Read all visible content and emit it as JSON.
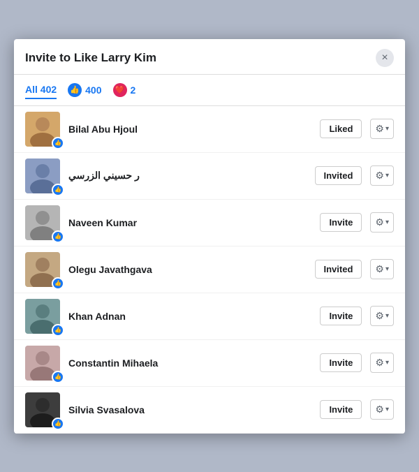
{
  "modal": {
    "title": "Invite to Like Larry Kim",
    "close_label": "×"
  },
  "tabs": [
    {
      "id": "all",
      "label": "All 402",
      "icon": null,
      "active": true
    },
    {
      "id": "like",
      "label": "400",
      "icon": "like",
      "active": false
    },
    {
      "id": "love",
      "label": "2",
      "icon": "love",
      "active": false
    }
  ],
  "people": [
    {
      "name": "Bilal Abu Hjoul",
      "action": "Liked",
      "actionType": "liked",
      "avatarColor": "#d4a76a",
      "avatarShape": "person1"
    },
    {
      "name": "ر حسيني الزرسي",
      "action": "Invited",
      "actionType": "invited",
      "avatarColor": "#8b9dc3",
      "avatarShape": "person2"
    },
    {
      "name": "Naveen Kumar",
      "action": "Invite",
      "actionType": "invite",
      "avatarColor": "#b5b5b5",
      "avatarShape": "person3"
    },
    {
      "name": "Olegu Javathgava",
      "action": "Invited",
      "actionType": "invited",
      "avatarColor": "#c4a882",
      "avatarShape": "person4"
    },
    {
      "name": "Khan Adnan",
      "action": "Invite",
      "actionType": "invite",
      "avatarColor": "#7a9e9f",
      "avatarShape": "person5"
    },
    {
      "name": "Constantin Mihaela",
      "action": "Invite",
      "actionType": "invite",
      "avatarColor": "#c7a8a8",
      "avatarShape": "person6"
    },
    {
      "name": "Silvia Svasalova",
      "action": "Invite",
      "actionType": "invite",
      "avatarColor": "#3d3d3d",
      "avatarShape": "person7"
    }
  ],
  "icons": {
    "like": "👍",
    "love": "❤️",
    "gear": "⚙",
    "chevron": "▾",
    "close": "×"
  }
}
